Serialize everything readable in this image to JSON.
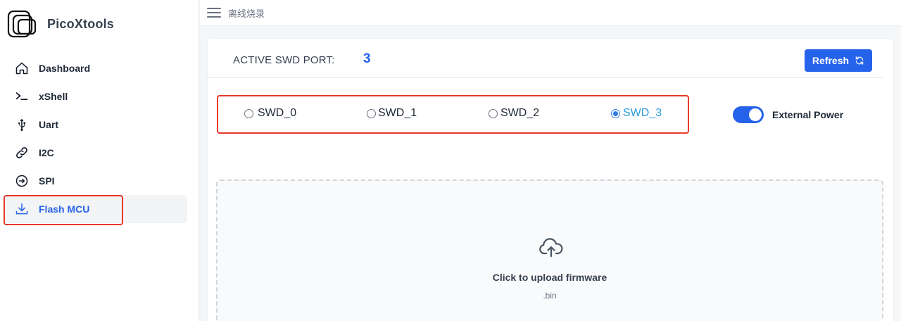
{
  "app": {
    "name": "PicoXtools"
  },
  "sidebar": {
    "items": [
      {
        "label": "Dashboard",
        "icon": "home-icon"
      },
      {
        "label": "xShell",
        "icon": "terminal-icon"
      },
      {
        "label": "Uart",
        "icon": "usb-icon"
      },
      {
        "label": "I2C",
        "icon": "link-icon"
      },
      {
        "label": "SPI",
        "icon": "arrow-circle-icon"
      },
      {
        "label": "Flash MCU",
        "icon": "download-icon",
        "active": true
      }
    ]
  },
  "topbar": {
    "breadcrumb": "离线烧录"
  },
  "swd": {
    "active_label": "ACTIVE SWD PORT:",
    "active_value": "3",
    "refresh_label": "Refresh",
    "options": [
      {
        "label": "SWD_0",
        "checked": false
      },
      {
        "label": "SWD_1",
        "checked": false
      },
      {
        "label": "SWD_2",
        "checked": false
      },
      {
        "label": "SWD_3",
        "checked": true
      }
    ],
    "external_power_label": "External Power",
    "external_power_on": true
  },
  "upload": {
    "title": "Click to upload firmware",
    "hint": ".bin"
  },
  "colors": {
    "accent": "#2563eb",
    "highlight_box": "#e83a2b",
    "checked_radio": "#2b7be4"
  }
}
